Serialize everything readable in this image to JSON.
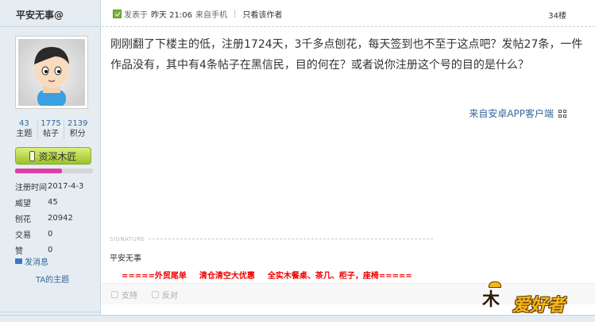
{
  "user": {
    "name": "平安无事@",
    "stats": [
      {
        "value": "43",
        "label": "主题"
      },
      {
        "value": "1775",
        "label": "帖子"
      },
      {
        "value": "2139",
        "label": "积分"
      }
    ],
    "rank": "资深木匠",
    "rank_progress": 0.6,
    "info": [
      {
        "key": "注册时间",
        "value": "2017-4-3"
      },
      {
        "key": "威望",
        "value": "45"
      },
      {
        "key": "刨花",
        "value": "20942"
      },
      {
        "key": "交易",
        "value": "0"
      },
      {
        "key": "赞",
        "value": "0"
      }
    ],
    "send_message": "发消息",
    "ta_topics": "TA的主题"
  },
  "post": {
    "posted_prefix": "发表于",
    "time": "昨天 21:06",
    "source": "来自手机",
    "author_only": "只看该作者",
    "floor": "34楼",
    "body": "刚刚翻了下楼主的低，注册1724天，3千多点刨花，每天签到也不至于这点吧？发帖27条，一件作品没有，其中有4条帖子在黑信民，目的何在？或者说你注册这个号的目的是什么？",
    "client": "来自安卓APP客户端",
    "signature_label": "SIGNATURE",
    "signature_name": "平安无事",
    "signature_ad": [
      "=====外贸尾单",
      "清仓清空大优惠",
      "全实木餐桌、茶几、柜子，座椅====="
    ],
    "support": "支持",
    "oppose": "反对"
  },
  "logo": {
    "wood": "木",
    "text": "爱好者"
  }
}
